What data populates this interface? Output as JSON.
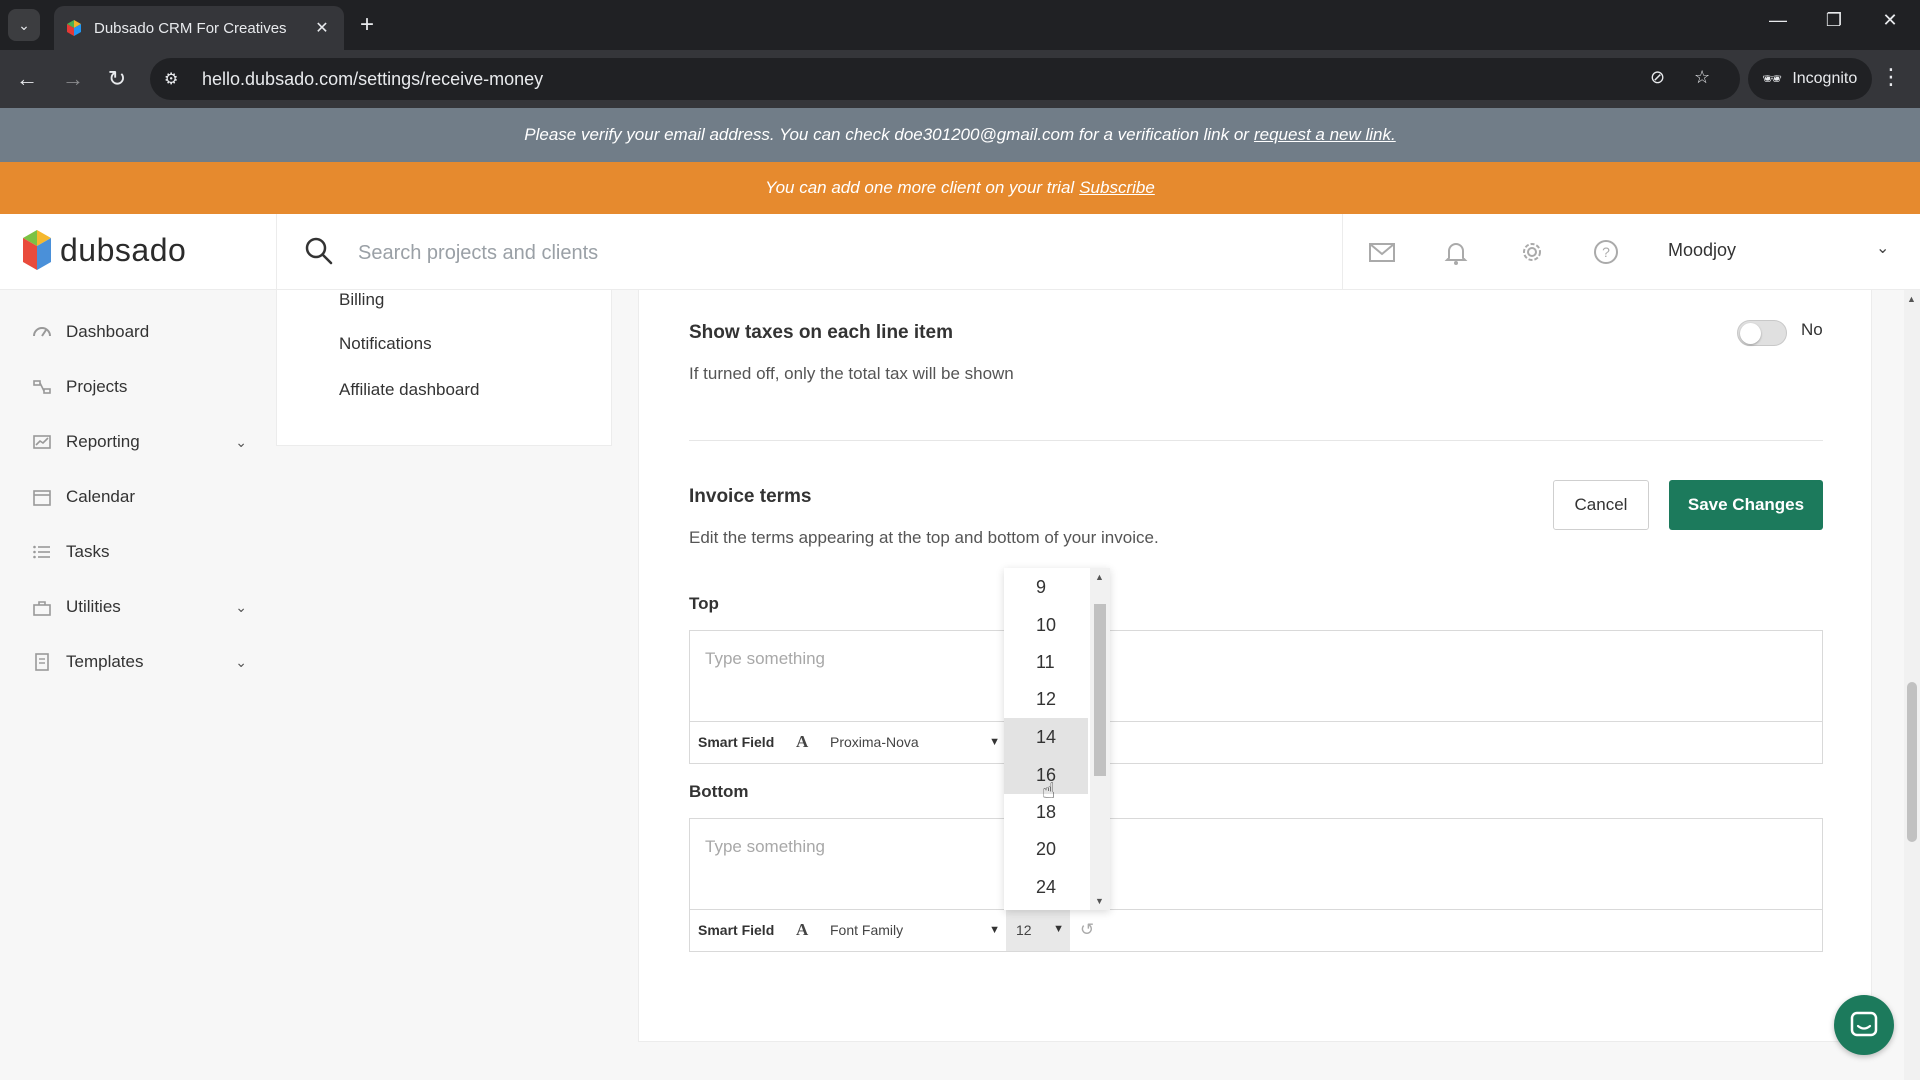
{
  "browser": {
    "tab_title": "Dubsado CRM For Creatives",
    "tab_close": "✕",
    "new_tab": "+",
    "url": "hello.dubsado.com/settings/receive-money",
    "incognito_label": "Incognito"
  },
  "banners": {
    "verify_text": "Please verify your email address. You can check doe301200@gmail.com for a verification link or",
    "verify_link": "request a new link.",
    "trial_text": "You can add one more client on your trial",
    "trial_link": "Subscribe"
  },
  "header": {
    "logo_text": "dubsado",
    "search_placeholder": "Search projects and clients",
    "user_name": "Moodjoy"
  },
  "sidebar": {
    "items": [
      {
        "label": "Dashboard",
        "icon": "dashboard-icon"
      },
      {
        "label": "Projects",
        "icon": "projects-icon"
      },
      {
        "label": "Reporting",
        "icon": "reporting-icon",
        "expandable": true
      },
      {
        "label": "Calendar",
        "icon": "calendar-icon"
      },
      {
        "label": "Tasks",
        "icon": "tasks-icon"
      },
      {
        "label": "Utilities",
        "icon": "utilities-icon",
        "expandable": true
      },
      {
        "label": "Templates",
        "icon": "templates-icon",
        "expandable": true
      }
    ]
  },
  "settings_menu": {
    "links": [
      "Billing",
      "Notifications",
      "Affiliate dashboard"
    ]
  },
  "main": {
    "taxes": {
      "title": "Show taxes on each line item",
      "description": "If turned off, only the total tax will be shown",
      "toggle_value": "No"
    },
    "invoice_terms": {
      "title": "Invoice terms",
      "description": "Edit the terms appearing at the top and bottom of your invoice.",
      "cancel_label": "Cancel",
      "save_label": "Save Changes",
      "top": {
        "label": "Top",
        "placeholder": "Type something",
        "smart_field": "Smart Field",
        "font_family": "Proxima-Nova"
      },
      "bottom": {
        "label": "Bottom",
        "placeholder": "Type something",
        "smart_field": "Smart Field",
        "font_family": "Font Family",
        "font_size": "12"
      }
    },
    "size_dropdown": {
      "options": [
        "9",
        "10",
        "11",
        "12",
        "14",
        "16",
        "18",
        "20",
        "24"
      ],
      "highlighted": [
        "14",
        "16"
      ]
    }
  },
  "colors": {
    "verify_banner": "#717d88",
    "trial_banner": "#e68a2e",
    "primary_button": "#1c7a5c"
  }
}
